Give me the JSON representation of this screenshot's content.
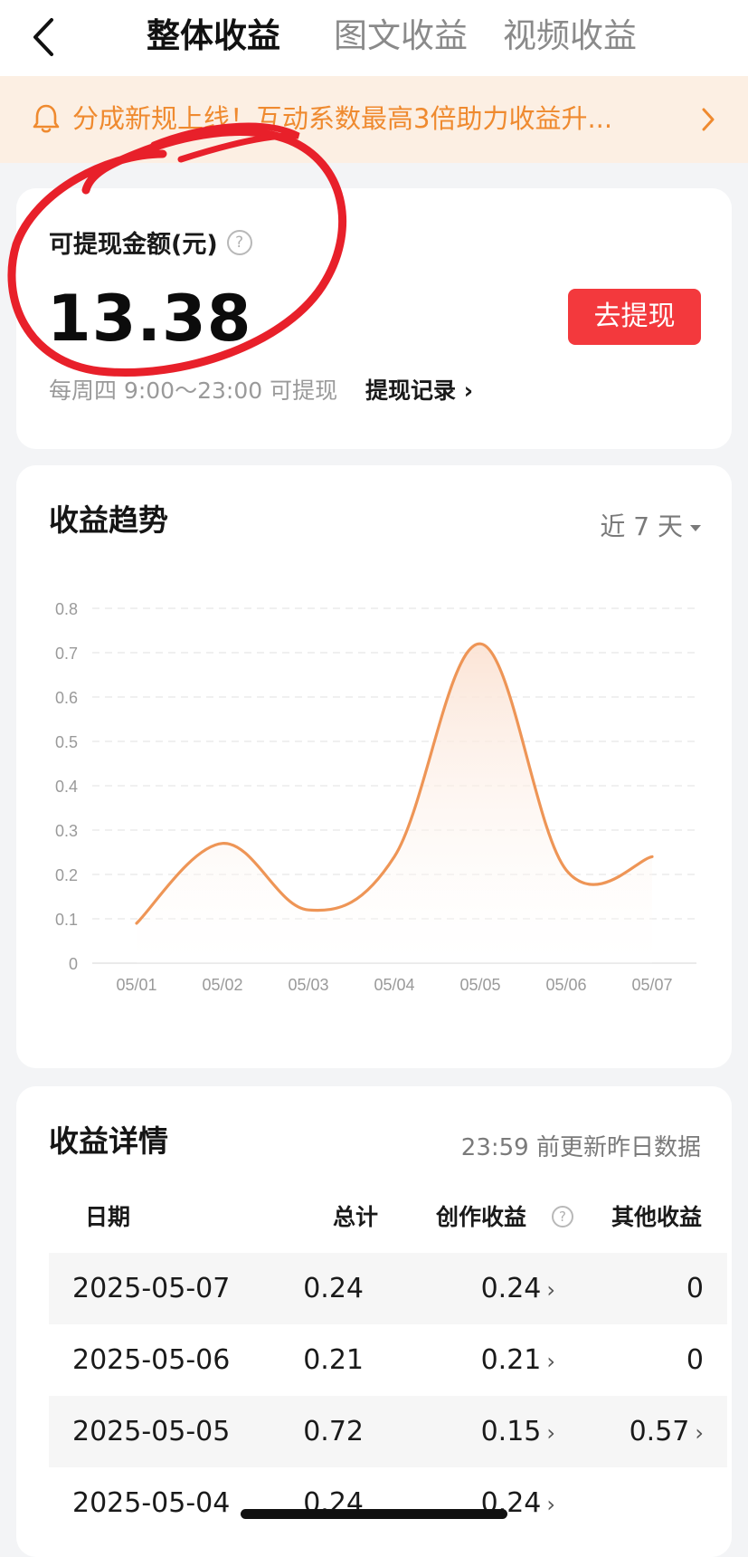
{
  "header": {
    "tabs": [
      {
        "label": "整体收益",
        "active": true
      },
      {
        "label": "图文收益",
        "active": false
      },
      {
        "label": "视频收益",
        "active": false
      }
    ]
  },
  "notice": {
    "text": "分成新规上线！互动系数最高3倍助力收益升..."
  },
  "balance": {
    "label": "可提现金额(元)",
    "amount": "13.38",
    "withdraw_label": "去提现",
    "schedule": "每周四 9:00～23:00 可提现",
    "record_label": "提现记录 ›"
  },
  "trend": {
    "title": "收益趋势",
    "range_label": "近 7 天"
  },
  "chart_data": {
    "type": "line",
    "categories": [
      "05/01",
      "05/02",
      "05/03",
      "05/04",
      "05/05",
      "05/06",
      "05/07"
    ],
    "series": [
      {
        "values": [
          0.09,
          0.27,
          0.12,
          0.24,
          0.72,
          0.21,
          0.24
        ]
      }
    ],
    "y_ticks": [
      "0",
      "0.1",
      "0.2",
      "0.3",
      "0.4",
      "0.5",
      "0.6",
      "0.7",
      "0.8"
    ],
    "ylim": [
      0,
      0.8
    ],
    "grid": true,
    "line_color": "#ee9556",
    "fill_color": "#fbe3d4"
  },
  "details": {
    "title": "收益详情",
    "updated": "23:59 前更新昨日数据",
    "columns": [
      "日期",
      "总计",
      "创作收益",
      "其他收益"
    ],
    "rows": [
      {
        "date": "2025-05-07",
        "total": "0.24",
        "creation": "0.24",
        "other": "0"
      },
      {
        "date": "2025-05-06",
        "total": "0.21",
        "creation": "0.21",
        "other": "0"
      },
      {
        "date": "2025-05-05",
        "total": "0.72",
        "creation": "0.15",
        "other": "0.57"
      },
      {
        "date": "2025-05-04",
        "total": "0.24",
        "creation": "0.24",
        "other": ""
      }
    ]
  },
  "colors": {
    "accent_red": "#f3393d",
    "notice_orange": "#ef8a2f",
    "notice_bg": "#fcefe3",
    "annotation_red": "#e8202a"
  }
}
